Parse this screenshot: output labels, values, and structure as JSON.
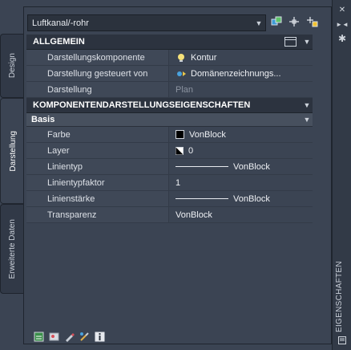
{
  "tabs": [
    {
      "label": "Design",
      "active": false
    },
    {
      "label": "Darstellung",
      "active": true
    },
    {
      "label": "Erweiterte Daten",
      "active": false
    }
  ],
  "toolbar": {
    "object_type": "Luftkanal/-rohr",
    "icons": [
      "quick-select-icon",
      "pick-point-icon",
      "select-objects-icon"
    ]
  },
  "sections": {
    "allgemein": {
      "title": "ALLGEMEIN",
      "rows": [
        {
          "label": "Darstellungskomponente",
          "value": "Kontur",
          "icon": "lightbulb-icon"
        },
        {
          "label": "Darstellung gesteuert von",
          "value": "Domänenzeichnungs...",
          "icon": "display-control-icon"
        },
        {
          "label": "Darstellung",
          "value": "Plan"
        }
      ]
    },
    "komponenten": {
      "title": "KOMPONENTENDARSTELLUNGSEIGENSCHAFTEN",
      "basis": {
        "title": "Basis",
        "rows": [
          {
            "label": "Farbe",
            "value": "VonBlock"
          },
          {
            "label": "Layer",
            "value": "0"
          },
          {
            "label": "Linientyp",
            "value": "VonBlock"
          },
          {
            "label": "Linientypfaktor",
            "value": "1"
          },
          {
            "label": "Linienstärke",
            "value": "VonBlock"
          },
          {
            "label": "Transparenz",
            "value": "VonBlock"
          }
        ]
      }
    }
  },
  "palette_title": "EIGENSCHAFTEN",
  "colors": {
    "background": "#3b4453",
    "header": "#2c333f",
    "accent_yellow": "#f2c230",
    "accent_blue": "#4aa3df"
  }
}
